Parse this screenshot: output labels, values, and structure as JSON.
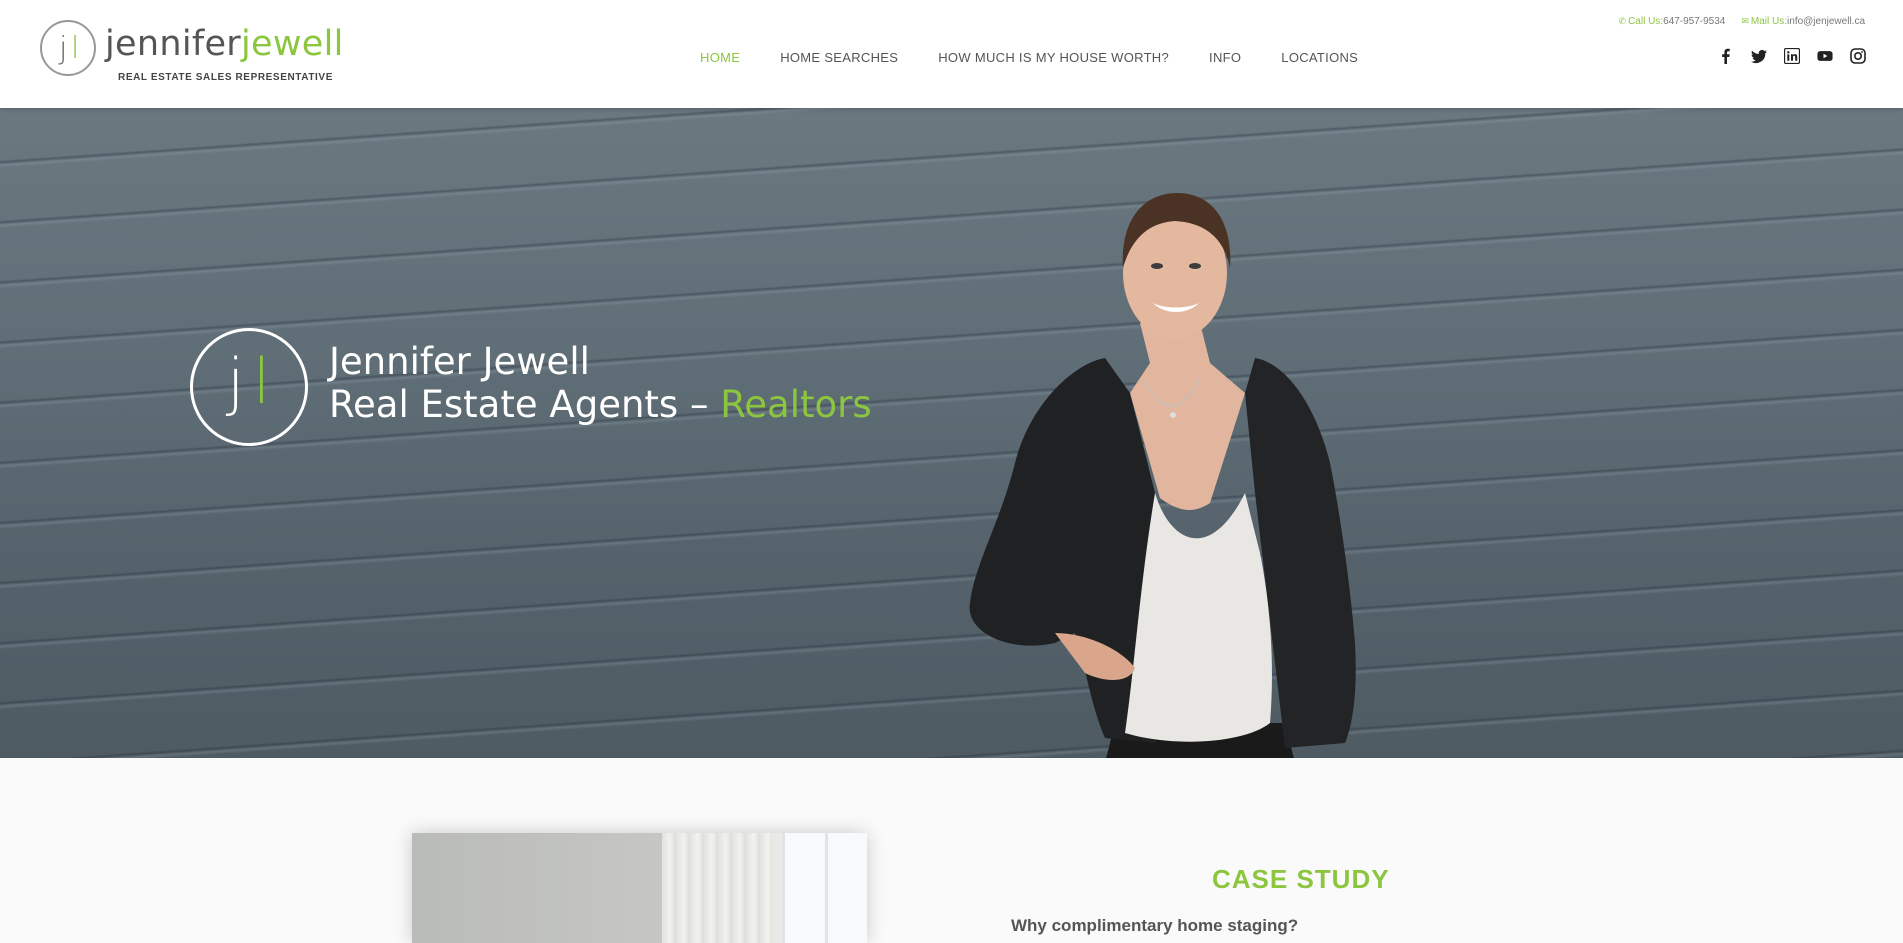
{
  "logo": {
    "mark_j": "j",
    "mark_l": "l",
    "name_first": "jennifer",
    "name_last": "jewell",
    "tagline": "REAL ESTATE SALES REPRESENTATIVE"
  },
  "nav": {
    "items": [
      {
        "label": "HOME",
        "active": true
      },
      {
        "label": "HOME SEARCHES",
        "active": false
      },
      {
        "label": "HOW MUCH IS MY HOUSE WORTH?",
        "active": false
      },
      {
        "label": "INFO",
        "active": false
      },
      {
        "label": "LOCATIONS",
        "active": false
      }
    ]
  },
  "contact": {
    "call_label": "Call Us:",
    "call_value": "647-957-9534",
    "mail_label": "Mail Us:",
    "mail_value": "info@jenjewell.ca"
  },
  "social": [
    "facebook-icon",
    "twitter-icon",
    "linkedin-icon",
    "youtube-icon",
    "instagram-icon"
  ],
  "hero": {
    "line1": "Jennifer Jewell",
    "line2_prefix": "Real Estate Agents – ",
    "line2_accent": "Realtors"
  },
  "case_study": {
    "title": "CASE STUDY",
    "subtitle": "Why complimentary home staging?"
  },
  "colors": {
    "accent": "#8cc63f",
    "text": "#555555"
  }
}
